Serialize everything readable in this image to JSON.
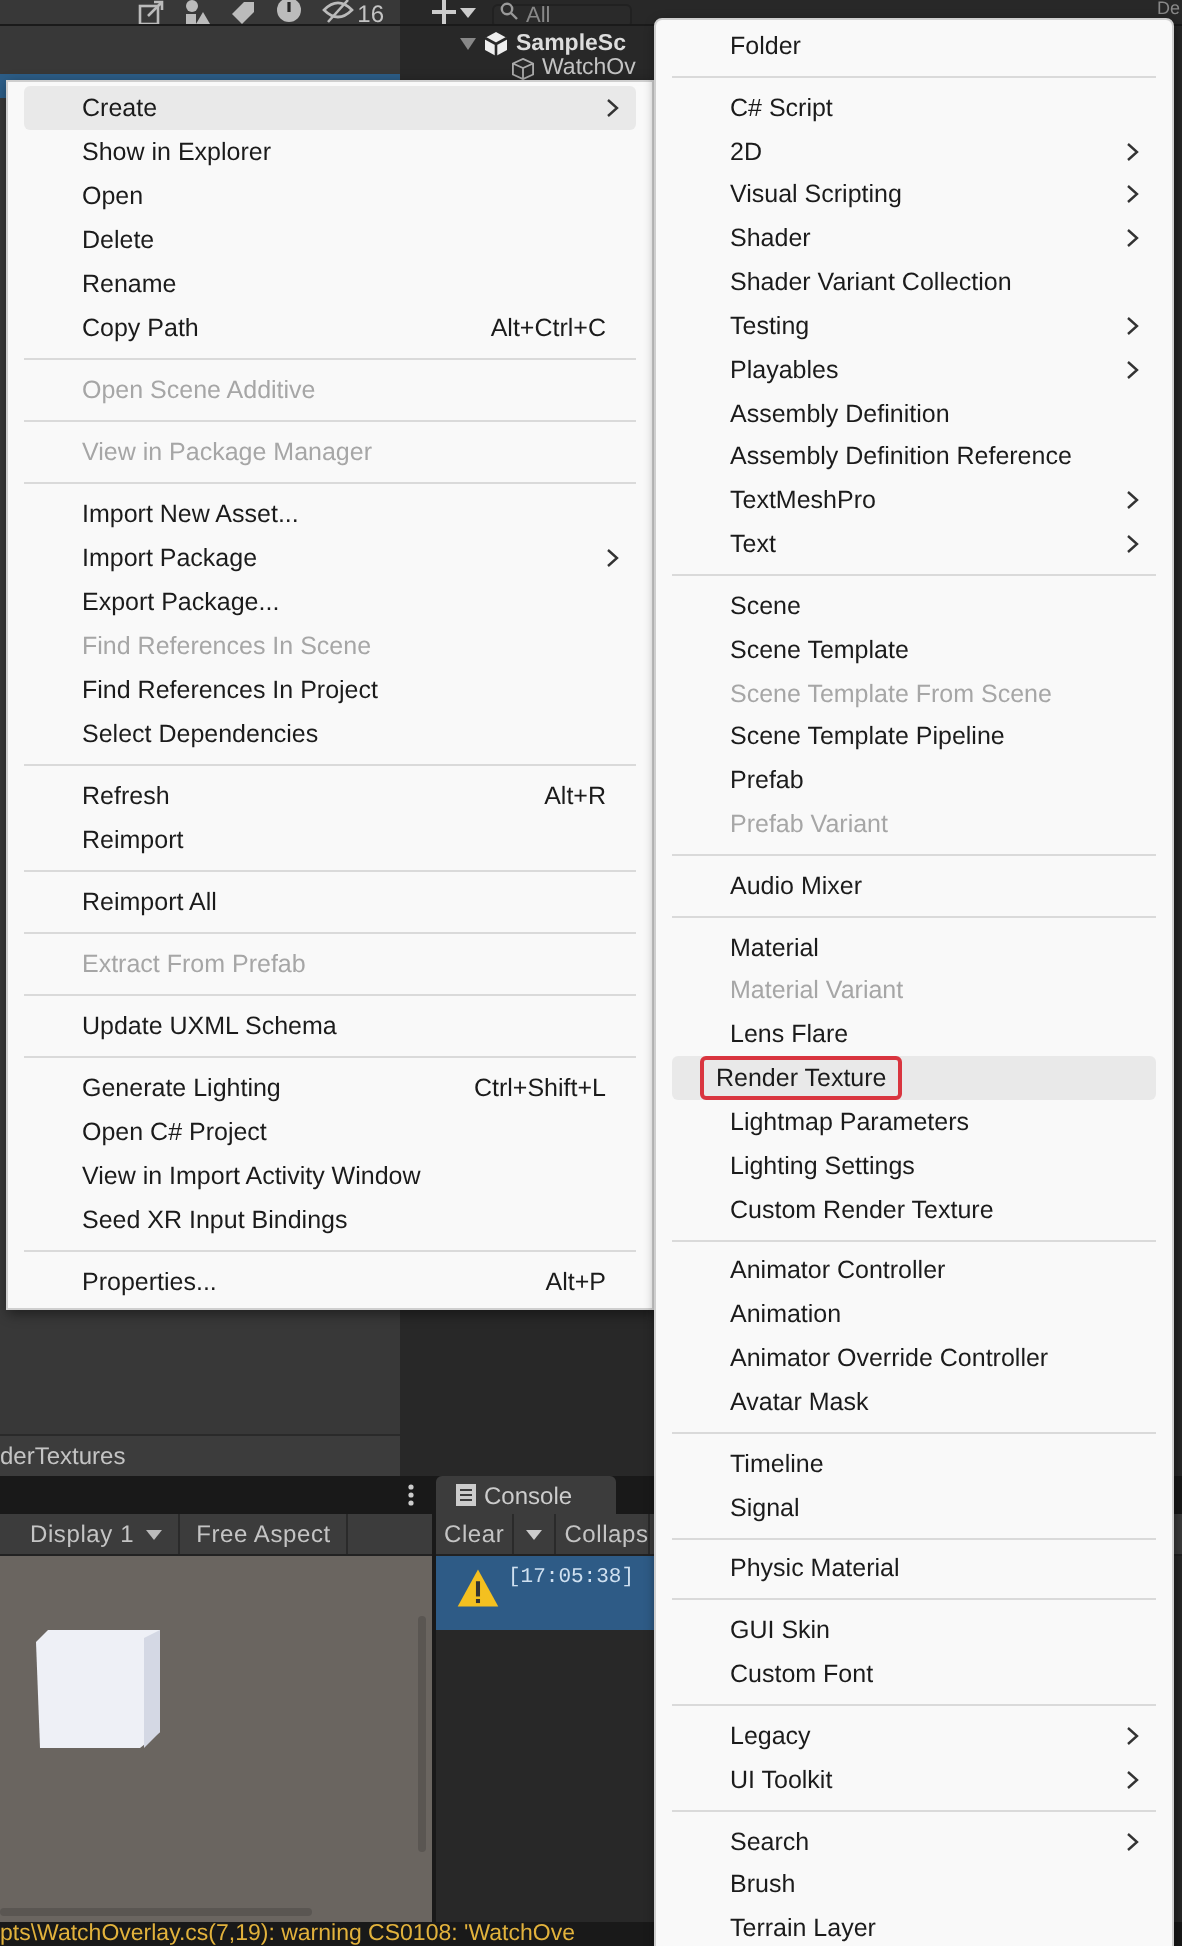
{
  "toolbar": {
    "hidden_count": "16",
    "search": {
      "placeholder": "All"
    },
    "corner_text": "De"
  },
  "project": {
    "selected_row": true,
    "footer_path": "derTextures"
  },
  "hierarchy": {
    "scene": "SampleSc",
    "items": [
      "WatchOv"
    ]
  },
  "game": {
    "display": "Display 1",
    "aspect": "Free Aspect"
  },
  "console": {
    "tab": "Console",
    "clear": "Clear",
    "collapse": "Collaps",
    "entries": [
      {
        "time": "[17:05:38]",
        "selected": true
      }
    ]
  },
  "status_bar": {
    "message": "pts\\WatchOverlay.cs(7,19): warning CS0108: 'WatchOve"
  },
  "context_menu": {
    "items": [
      {
        "kind": "item",
        "label": "Create",
        "submenu": true,
        "disabled": false,
        "selected": true,
        "outlined": false
      },
      {
        "kind": "item",
        "label": "Show in Explorer",
        "submenu": false,
        "disabled": false,
        "selected": false,
        "outlined": false
      },
      {
        "kind": "item",
        "label": "Open",
        "submenu": false,
        "disabled": false,
        "selected": false,
        "outlined": false
      },
      {
        "kind": "item",
        "label": "Delete",
        "submenu": false,
        "disabled": false,
        "selected": false,
        "outlined": false
      },
      {
        "kind": "item",
        "label": "Rename",
        "submenu": false,
        "disabled": false,
        "selected": false,
        "outlined": false
      },
      {
        "kind": "item",
        "label": "Copy Path",
        "shortcut": "Alt+Ctrl+C",
        "submenu": false,
        "disabled": false,
        "selected": false,
        "outlined": false
      },
      {
        "kind": "separator"
      },
      {
        "kind": "item",
        "label": "Open Scene Additive",
        "submenu": false,
        "disabled": true,
        "selected": false,
        "outlined": false
      },
      {
        "kind": "separator"
      },
      {
        "kind": "item",
        "label": "View in Package Manager",
        "submenu": false,
        "disabled": true,
        "selected": false,
        "outlined": false
      },
      {
        "kind": "separator"
      },
      {
        "kind": "item",
        "label": "Import New Asset...",
        "submenu": false,
        "disabled": false,
        "selected": false,
        "outlined": false
      },
      {
        "kind": "item",
        "label": "Import Package",
        "submenu": true,
        "disabled": false,
        "selected": false,
        "outlined": false
      },
      {
        "kind": "item",
        "label": "Export Package...",
        "submenu": false,
        "disabled": false,
        "selected": false,
        "outlined": false
      },
      {
        "kind": "item",
        "label": "Find References In Scene",
        "submenu": false,
        "disabled": true,
        "selected": false,
        "outlined": false
      },
      {
        "kind": "item",
        "label": "Find References In Project",
        "submenu": false,
        "disabled": false,
        "selected": false,
        "outlined": false
      },
      {
        "kind": "item",
        "label": "Select Dependencies",
        "submenu": false,
        "disabled": false,
        "selected": false,
        "outlined": false
      },
      {
        "kind": "separator"
      },
      {
        "kind": "item",
        "label": "Refresh",
        "shortcut": "Alt+R",
        "submenu": false,
        "disabled": false,
        "selected": false,
        "outlined": false
      },
      {
        "kind": "item",
        "label": "Reimport",
        "submenu": false,
        "disabled": false,
        "selected": false,
        "outlined": false
      },
      {
        "kind": "separator"
      },
      {
        "kind": "item",
        "label": "Reimport All",
        "submenu": false,
        "disabled": false,
        "selected": false,
        "outlined": false
      },
      {
        "kind": "separator"
      },
      {
        "kind": "item",
        "label": "Extract From Prefab",
        "submenu": false,
        "disabled": true,
        "selected": false,
        "outlined": false
      },
      {
        "kind": "separator"
      },
      {
        "kind": "item",
        "label": "Update UXML Schema",
        "submenu": false,
        "disabled": false,
        "selected": false,
        "outlined": false
      },
      {
        "kind": "separator"
      },
      {
        "kind": "item",
        "label": "Generate Lighting",
        "shortcut": "Ctrl+Shift+L",
        "submenu": false,
        "disabled": false,
        "selected": false,
        "outlined": false
      },
      {
        "kind": "item",
        "label": "Open C# Project",
        "submenu": false,
        "disabled": false,
        "selected": false,
        "outlined": false
      },
      {
        "kind": "item",
        "label": "View in Import Activity Window",
        "submenu": false,
        "disabled": false,
        "selected": false,
        "outlined": false
      },
      {
        "kind": "item",
        "label": "Seed XR Input Bindings",
        "submenu": false,
        "disabled": false,
        "selected": false,
        "outlined": false
      },
      {
        "kind": "separator"
      },
      {
        "kind": "item",
        "label": "Properties...",
        "shortcut": "Alt+P",
        "submenu": false,
        "disabled": false,
        "selected": false,
        "outlined": false
      }
    ]
  },
  "submenu": {
    "items": [
      {
        "kind": "item",
        "label": "Folder",
        "submenu": false,
        "disabled": false,
        "selected": false,
        "outlined": false
      },
      {
        "kind": "separator"
      },
      {
        "kind": "item",
        "label": "C# Script",
        "submenu": false,
        "disabled": false,
        "selected": false,
        "outlined": false
      },
      {
        "kind": "item",
        "label": "2D",
        "submenu": true,
        "disabled": false,
        "selected": false,
        "outlined": false
      },
      {
        "kind": "item",
        "label": "Visual Scripting",
        "submenu": true,
        "disabled": false,
        "selected": false,
        "outlined": false
      },
      {
        "kind": "item",
        "label": "Shader",
        "submenu": true,
        "disabled": false,
        "selected": false,
        "outlined": false
      },
      {
        "kind": "item",
        "label": "Shader Variant Collection",
        "submenu": false,
        "disabled": false,
        "selected": false,
        "outlined": false
      },
      {
        "kind": "item",
        "label": "Testing",
        "submenu": true,
        "disabled": false,
        "selected": false,
        "outlined": false
      },
      {
        "kind": "item",
        "label": "Playables",
        "submenu": true,
        "disabled": false,
        "selected": false,
        "outlined": false
      },
      {
        "kind": "item",
        "label": "Assembly Definition",
        "submenu": false,
        "disabled": false,
        "selected": false,
        "outlined": false
      },
      {
        "kind": "item",
        "label": "Assembly Definition Reference",
        "submenu": false,
        "disabled": false,
        "selected": false,
        "outlined": false
      },
      {
        "kind": "item",
        "label": "TextMeshPro",
        "submenu": true,
        "disabled": false,
        "selected": false,
        "outlined": false
      },
      {
        "kind": "item",
        "label": "Text",
        "submenu": true,
        "disabled": false,
        "selected": false,
        "outlined": false
      },
      {
        "kind": "separator"
      },
      {
        "kind": "item",
        "label": "Scene",
        "submenu": false,
        "disabled": false,
        "selected": false,
        "outlined": false
      },
      {
        "kind": "item",
        "label": "Scene Template",
        "submenu": false,
        "disabled": false,
        "selected": false,
        "outlined": false
      },
      {
        "kind": "item",
        "label": "Scene Template From Scene",
        "submenu": false,
        "disabled": true,
        "selected": false,
        "outlined": false
      },
      {
        "kind": "item",
        "label": "Scene Template Pipeline",
        "submenu": false,
        "disabled": false,
        "selected": false,
        "outlined": false
      },
      {
        "kind": "item",
        "label": "Prefab",
        "submenu": false,
        "disabled": false,
        "selected": false,
        "outlined": false
      },
      {
        "kind": "item",
        "label": "Prefab Variant",
        "submenu": false,
        "disabled": true,
        "selected": false,
        "outlined": false
      },
      {
        "kind": "separator"
      },
      {
        "kind": "item",
        "label": "Audio Mixer",
        "submenu": false,
        "disabled": false,
        "selected": false,
        "outlined": false
      },
      {
        "kind": "separator"
      },
      {
        "kind": "item",
        "label": "Material",
        "submenu": false,
        "disabled": false,
        "selected": false,
        "outlined": false
      },
      {
        "kind": "item",
        "label": "Material Variant",
        "submenu": false,
        "disabled": true,
        "selected": false,
        "outlined": false
      },
      {
        "kind": "item",
        "label": "Lens Flare",
        "submenu": false,
        "disabled": false,
        "selected": false,
        "outlined": false
      },
      {
        "kind": "item",
        "label": "Render Texture",
        "submenu": false,
        "disabled": false,
        "selected": true,
        "outlined": true
      },
      {
        "kind": "item",
        "label": "Lightmap Parameters",
        "submenu": false,
        "disabled": false,
        "selected": false,
        "outlined": false
      },
      {
        "kind": "item",
        "label": "Lighting Settings",
        "submenu": false,
        "disabled": false,
        "selected": false,
        "outlined": false
      },
      {
        "kind": "item",
        "label": "Custom Render Texture",
        "submenu": false,
        "disabled": false,
        "selected": false,
        "outlined": false
      },
      {
        "kind": "separator"
      },
      {
        "kind": "item",
        "label": "Animator Controller",
        "submenu": false,
        "disabled": false,
        "selected": false,
        "outlined": false
      },
      {
        "kind": "item",
        "label": "Animation",
        "submenu": false,
        "disabled": false,
        "selected": false,
        "outlined": false
      },
      {
        "kind": "item",
        "label": "Animator Override Controller",
        "submenu": false,
        "disabled": false,
        "selected": false,
        "outlined": false
      },
      {
        "kind": "item",
        "label": "Avatar Mask",
        "submenu": false,
        "disabled": false,
        "selected": false,
        "outlined": false
      },
      {
        "kind": "separator"
      },
      {
        "kind": "item",
        "label": "Timeline",
        "submenu": false,
        "disabled": false,
        "selected": false,
        "outlined": false
      },
      {
        "kind": "item",
        "label": "Signal",
        "submenu": false,
        "disabled": false,
        "selected": false,
        "outlined": false
      },
      {
        "kind": "separator"
      },
      {
        "kind": "item",
        "label": "Physic Material",
        "submenu": false,
        "disabled": false,
        "selected": false,
        "outlined": false
      },
      {
        "kind": "separator"
      },
      {
        "kind": "item",
        "label": "GUI Skin",
        "submenu": false,
        "disabled": false,
        "selected": false,
        "outlined": false
      },
      {
        "kind": "item",
        "label": "Custom Font",
        "submenu": false,
        "disabled": false,
        "selected": false,
        "outlined": false
      },
      {
        "kind": "separator"
      },
      {
        "kind": "item",
        "label": "Legacy",
        "submenu": true,
        "disabled": false,
        "selected": false,
        "outlined": false
      },
      {
        "kind": "item",
        "label": "UI Toolkit",
        "submenu": true,
        "disabled": false,
        "selected": false,
        "outlined": false
      },
      {
        "kind": "separator"
      },
      {
        "kind": "item",
        "label": "Search",
        "submenu": true,
        "disabled": false,
        "selected": false,
        "outlined": false
      },
      {
        "kind": "item",
        "label": "Brush",
        "submenu": false,
        "disabled": false,
        "selected": false,
        "outlined": false
      },
      {
        "kind": "item",
        "label": "Terrain Layer",
        "submenu": false,
        "disabled": false,
        "selected": false,
        "outlined": false
      }
    ]
  }
}
